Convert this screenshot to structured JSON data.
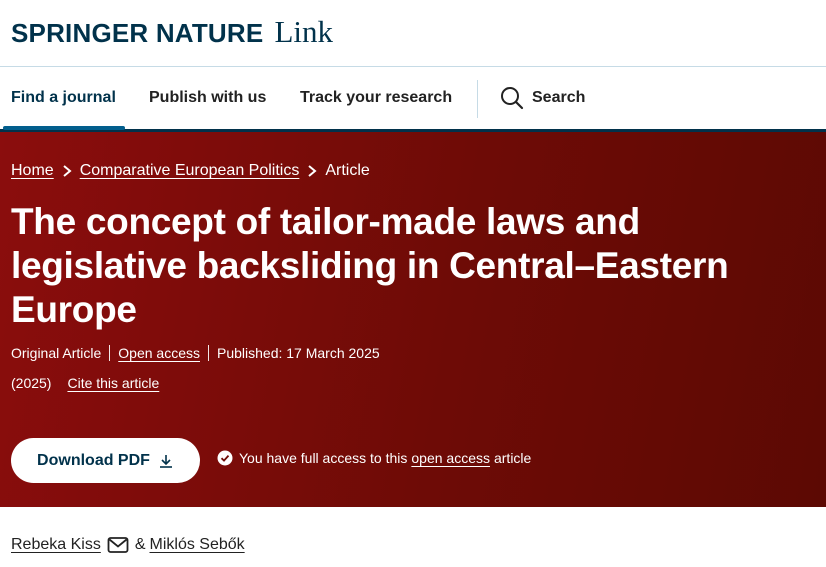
{
  "brand": {
    "name": "SPRINGER NATURE",
    "product": "Link"
  },
  "nav": {
    "items": [
      {
        "label": "Find a journal",
        "active": true
      },
      {
        "label": "Publish with us"
      },
      {
        "label": "Track your research"
      }
    ],
    "search_label": "Search",
    "search_icon": "search-icon"
  },
  "hero": {
    "breadcrumb": [
      "Home",
      "Comparative European Politics",
      "Article"
    ],
    "title": "The concept of tailor-made laws and legislative backsliding in Central–Eastern Europe",
    "article_type": "Original Article",
    "open_access": "Open access",
    "published": "Published: 17 March 2025",
    "year": "(2025)",
    "cite": "Cite this article",
    "download_label": "Download PDF",
    "access_note_pre": "You have full access to this",
    "access_note_link": "open access",
    "access_note_post": "article",
    "colors": {
      "background": "#7a0c08",
      "text": "#ffffff"
    }
  },
  "authors": [
    {
      "name": "Rebeka Kiss",
      "icon": "mail-icon"
    },
    {
      "name": "Miklós Sebők"
    }
  ],
  "authors_joiner": "&"
}
